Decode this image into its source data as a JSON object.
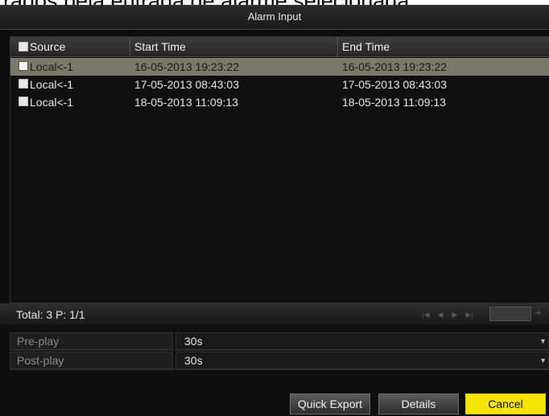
{
  "background_text": "rados pela entrada de alarme selecionada.",
  "dialog": {
    "title": "Alarm Input",
    "table": {
      "headers": {
        "source": "Source",
        "start": "Start Time",
        "end": "End Time"
      },
      "rows": [
        {
          "source": "Local<-1",
          "start": "16-05-2013 19:23:22",
          "end": "16-05-2013 19:23:22",
          "selected": true
        },
        {
          "source": "Local<-1",
          "start": "17-05-2013 08:43:03",
          "end": "17-05-2013 08:43:03",
          "selected": false
        },
        {
          "source": "Local<-1",
          "start": "18-05-2013 11:09:13",
          "end": "18-05-2013 11:09:13",
          "selected": false
        }
      ]
    },
    "footer": {
      "total": "Total: 3  P: 1/1"
    },
    "fields": {
      "preplay": {
        "label": "Pre-play",
        "value": "30s"
      },
      "postplay": {
        "label": "Post-play",
        "value": "30s"
      }
    },
    "buttons": {
      "quick_export": "Quick Export",
      "details": "Details",
      "cancel": "Cancel"
    }
  },
  "colors": {
    "selected_row": "#7a7868",
    "cancel_button": "#f5e400",
    "dialog_bg": "#0f0f0f"
  }
}
